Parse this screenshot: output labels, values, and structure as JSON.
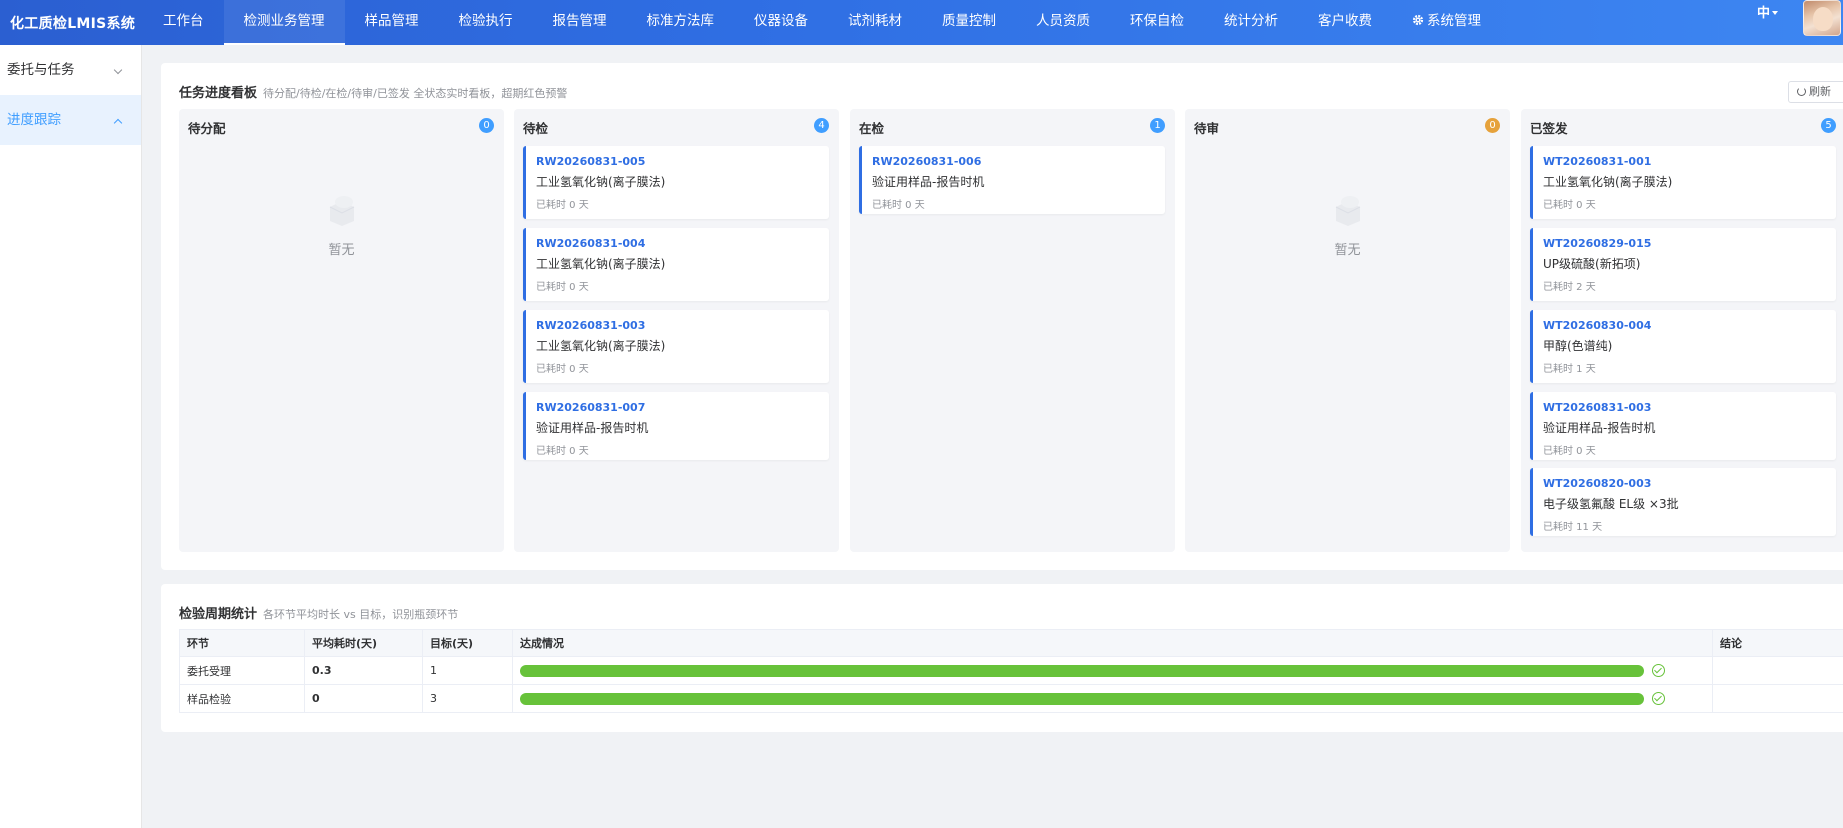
{
  "app": {
    "title": "化工质检LMIS系统"
  },
  "nav": {
    "items": [
      "工作台",
      "检测业务管理",
      "样品管理",
      "检验执行",
      "报告管理",
      "标准方法库",
      "仪器设备",
      "试剂耗材",
      "质量控制",
      "人员资质",
      "环保自检",
      "统计分析",
      "客户收费",
      "系统管理"
    ],
    "lang": "中"
  },
  "sidebar": {
    "items": [
      {
        "label": "委托与任务"
      },
      {
        "label": "进度跟踪"
      }
    ]
  },
  "board": {
    "title": "任务进度看板",
    "subtitle": "待分配/待检/在检/待审/已签发 全状态实时看板，超期红色预警",
    "refresh_label": "刷新",
    "empty_label": "暂无",
    "columns": [
      {
        "title": "待分配",
        "count": "0",
        "cards": []
      },
      {
        "title": "待检",
        "count": "4",
        "cards": [
          {
            "code": "RW20260831-005",
            "name": "工业氢氧化钠(离子膜法)",
            "time": "已耗时 0 天"
          },
          {
            "code": "RW20260831-004",
            "name": "工业氢氧化钠(离子膜法)",
            "time": "已耗时 0 天"
          },
          {
            "code": "RW20260831-003",
            "name": "工业氢氧化钠(离子膜法)",
            "time": "已耗时 0 天"
          },
          {
            "code": "RW20260831-007",
            "name": "验证用样品-报告时机",
            "time": "已耗时 0 天"
          }
        ]
      },
      {
        "title": "在检",
        "count": "1",
        "cards": [
          {
            "code": "RW20260831-006",
            "name": "验证用样品-报告时机",
            "time": "已耗时 0 天"
          }
        ]
      },
      {
        "title": "待审",
        "count": "0",
        "cards": []
      },
      {
        "title": "已签发",
        "count": "5",
        "cards": [
          {
            "code": "WT20260831-001",
            "name": "工业氢氧化钠(离子膜法)",
            "time": "已耗时 0 天"
          },
          {
            "code": "WT20260829-015",
            "name": "UP级硫酸(新拓项)",
            "time": "已耗时 2 天"
          },
          {
            "code": "WT20260830-004",
            "name": "甲醇(色谱纯)",
            "time": "已耗时 1 天"
          },
          {
            "code": "WT20260831-003",
            "name": "验证用样品-报告时机",
            "time": "已耗时 0 天"
          },
          {
            "code": "WT20260820-003",
            "name": "电子级氢氟酸 EL级 ×3批",
            "time": "已耗时 11 天"
          }
        ]
      }
    ]
  },
  "cycle": {
    "title": "检验周期统计",
    "subtitle": "各环节平均时长 vs 目标，识别瓶颈环节",
    "headers": [
      "环节",
      "平均耗时(天)",
      "目标(天)",
      "达成情况",
      "结论"
    ],
    "rows": [
      {
        "stage": "委托受理",
        "avg": "0.3",
        "target": "1",
        "achievement": 1.0,
        "conclusion": ""
      },
      {
        "stage": "样品检验",
        "avg": "0",
        "target": "3",
        "achievement": 1.0,
        "conclusion": ""
      }
    ]
  },
  "colors": {
    "primary": "#2f6ee3",
    "success": "#67c23a",
    "warning": "#e6a23c"
  }
}
